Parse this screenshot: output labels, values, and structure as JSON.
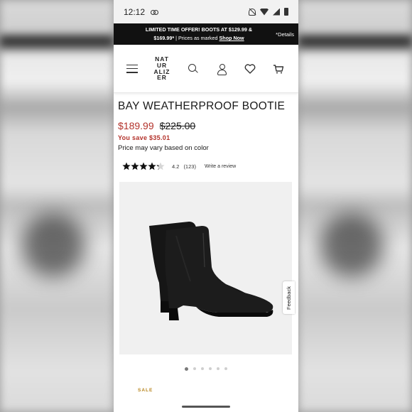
{
  "status": {
    "time": "12:12"
  },
  "promo": {
    "line1": "LIMITED TIME OFFER! BOOTS AT $129.99 &",
    "line2_prefix": "$169.99*",
    "line2_mid": " | Prices as marked ",
    "line2_link": "Shop Now",
    "details": "*Details"
  },
  "header": {
    "logo_lines": [
      "NAT",
      "UR",
      "ALIZ",
      "ER"
    ]
  },
  "product": {
    "title": "BAY WEATHERPROOF BOOTIE",
    "price_now": "$189.99",
    "price_was": "$225.00",
    "save_text": "You save $35.01",
    "vary_text": "Price may vary based on color",
    "rating": "4.2",
    "review_count": "(123)",
    "write_review": "Write a review",
    "stars_value": 4.2,
    "feedback": "Feedback",
    "gallery_count": 6,
    "gallery_active": 1,
    "badge": "SALE"
  },
  "colors": {
    "sale_red": "#b3322b",
    "promo_bg": "#111111",
    "badge_gold": "#b8861f"
  }
}
